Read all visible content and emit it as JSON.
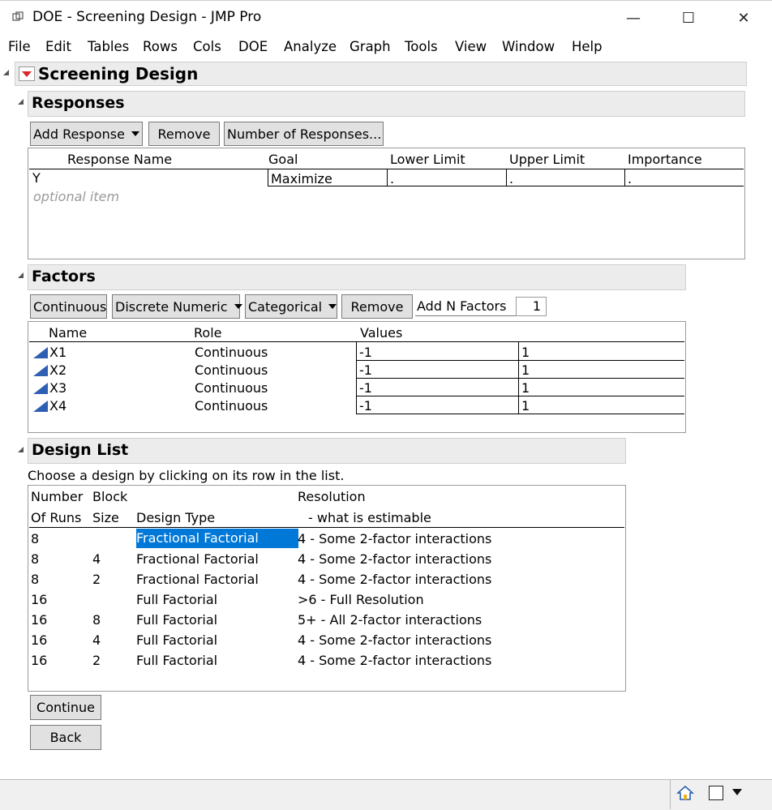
{
  "window": {
    "title": "DOE - Screening Design - JMP Pro",
    "minimize_glyph": "—",
    "maximize_glyph": "☐",
    "close_glyph": "✕"
  },
  "menu": [
    "File",
    "Edit",
    "Tables",
    "Rows",
    "Cols",
    "DOE",
    "Analyze",
    "Graph",
    "Tools",
    "View",
    "Window",
    "Help"
  ],
  "screening": {
    "title": "Screening Design"
  },
  "responses": {
    "title": "Responses",
    "buttons": {
      "add": "Add Response",
      "remove": "Remove",
      "number": "Number of Responses..."
    },
    "headers": [
      "Response Name",
      "Goal",
      "Lower Limit",
      "Upper Limit",
      "Importance"
    ],
    "rows": [
      {
        "name": "Y",
        "goal": "Maximize",
        "lower": ".",
        "upper": ".",
        "importance": "."
      }
    ],
    "optional_item": "optional item"
  },
  "factors": {
    "title": "Factors",
    "buttons": {
      "continuous": "Continuous",
      "discrete": "Discrete Numeric",
      "categorical": "Categorical",
      "remove": "Remove"
    },
    "add_n_label": "Add N Factors",
    "add_n_value": "1",
    "headers": [
      "Name",
      "Role",
      "Values"
    ],
    "rows": [
      {
        "name": "X1",
        "role": "Continuous",
        "low": "-1",
        "high": "1"
      },
      {
        "name": "X2",
        "role": "Continuous",
        "low": "-1",
        "high": "1"
      },
      {
        "name": "X3",
        "role": "Continuous",
        "low": "-1",
        "high": "1"
      },
      {
        "name": "X4",
        "role": "Continuous",
        "low": "-1",
        "high": "1"
      }
    ]
  },
  "design_list": {
    "title": "Design List",
    "instruction": "Choose a design by clicking on its row in the list.",
    "headers": {
      "runs_1": "Number",
      "runs_2": "Of Runs",
      "block_1": "Block",
      "block_2": "Size",
      "type": "Design Type",
      "res_1": "Resolution",
      "res_2": "- what is estimable"
    },
    "rows": [
      {
        "runs": "8",
        "block": "",
        "type": "Fractional Factorial",
        "resolution": "4 - Some 2-factor interactions",
        "selected": true
      },
      {
        "runs": "8",
        "block": "4",
        "type": "Fractional Factorial",
        "resolution": "4 - Some 2-factor interactions"
      },
      {
        "runs": "8",
        "block": "2",
        "type": "Fractional Factorial",
        "resolution": "4 - Some 2-factor interactions"
      },
      {
        "runs": "16",
        "block": "",
        "type": "Full Factorial",
        "resolution": ">6 - Full Resolution"
      },
      {
        "runs": "16",
        "block": "8",
        "type": "Full Factorial",
        "resolution": "5+ - All 2-factor interactions"
      },
      {
        "runs": "16",
        "block": "4",
        "type": "Full Factorial",
        "resolution": "4 - Some 2-factor interactions"
      },
      {
        "runs": "16",
        "block": "2",
        "type": "Full Factorial",
        "resolution": "4 - Some 2-factor interactions"
      }
    ]
  },
  "actions": {
    "continue": "Continue",
    "back": "Back"
  },
  "colors": {
    "selection": "#0078d7",
    "section_header": "#ececec",
    "disclosure_red": "#d9262b",
    "factor_icon": "#2f5fb3"
  }
}
